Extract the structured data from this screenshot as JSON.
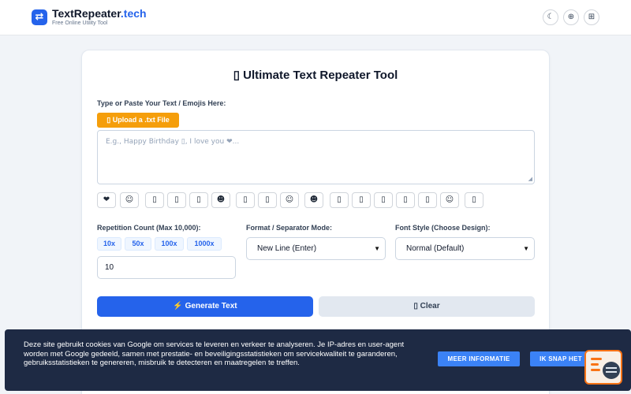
{
  "header": {
    "brand_name": "TextRepeater",
    "brand_tld": ".tech",
    "tagline": "Free Online Utility Tool",
    "logo_glyph": "⇄",
    "icons": [
      {
        "name": "moon-icon",
        "glyph": "☾"
      },
      {
        "name": "globe-icon",
        "glyph": "⊕"
      },
      {
        "name": "grid-icon",
        "glyph": "⊞"
      }
    ]
  },
  "main": {
    "title": "▯ Ultimate Text Repeater Tool",
    "input_label": "Type or Paste Your Text / Emojis Here:",
    "upload_label": "▯ Upload a .txt File",
    "textarea_placeholder": "E.g., Happy Birthday ▯, I love you ❤...",
    "emojis": [
      "❤",
      "☺",
      "▯",
      "▯",
      "▯",
      "☻",
      "▯",
      "▯",
      "☺",
      "☻",
      "▯",
      "▯",
      "▯",
      "▯",
      "▯",
      "☺",
      "▯"
    ],
    "repetition_label": "Repetition Count (Max 10,000):",
    "quick_counts": [
      "10x",
      "50x",
      "100x",
      "1000x"
    ],
    "count_value": "10",
    "format_label": "Format / Separator Mode:",
    "format_selected": "New Line (Enter)",
    "font_label": "Font Style (Choose Design):",
    "font_selected": "Normal (Default)",
    "generate_label": "⚡ Generate Text",
    "clear_label": "▯ Clear"
  },
  "cookie_banner": {
    "text": "Deze site gebruikt cookies van Google om services te leveren en verkeer te analyseren. Je IP-adres en user-agent worden met Google gedeeld, samen met prestatie- en beveiligingsstatistieken om servicekwaliteit te garanderen, gebruiksstatistieken te genereren, misbruik te detecteren en maatregelen te treffen.",
    "more_info_label": "MEER INFORMATIE",
    "accept_label": "IK SNAP HET"
  },
  "colors": {
    "accent": "#2563eb",
    "upload": "#f59e0b",
    "banner_bg": "#1e2a44"
  }
}
